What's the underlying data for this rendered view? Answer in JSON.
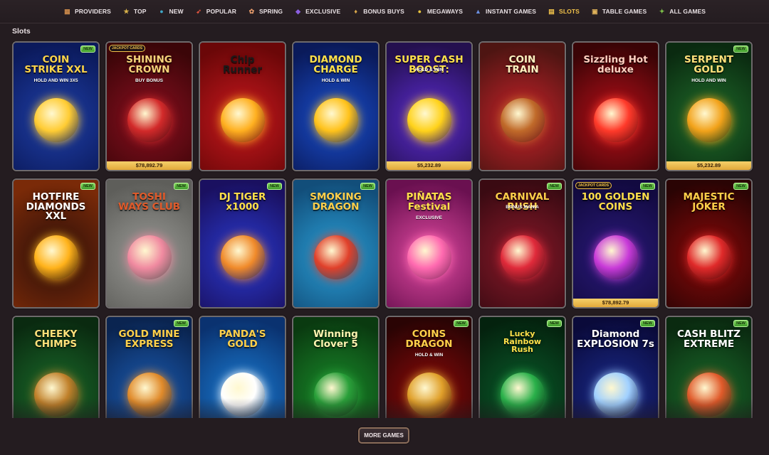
{
  "nav": {
    "items": [
      {
        "label": "PROVIDERS",
        "icon": "providers-icon",
        "glyph": "▦",
        "color": "#c9884a"
      },
      {
        "label": "TOP",
        "icon": "star-icon",
        "glyph": "★",
        "color": "#d8b24a"
      },
      {
        "label": "NEW",
        "icon": "globe-icon",
        "glyph": "●",
        "color": "#3fa7c7"
      },
      {
        "label": "POPULAR",
        "icon": "rocket-icon",
        "glyph": "➶",
        "color": "#e0553f"
      },
      {
        "label": "SPRING",
        "icon": "flower-icon",
        "glyph": "✿",
        "color": "#e59a6a"
      },
      {
        "label": "EXCLUSIVE",
        "icon": "gem-icon",
        "glyph": "◆",
        "color": "#8b5fe0"
      },
      {
        "label": "BONUS BUYS",
        "icon": "money-bag-icon",
        "glyph": "♦",
        "color": "#d9a84a"
      },
      {
        "label": "MEGAWAYS",
        "icon": "coin-icon",
        "glyph": "●",
        "color": "#e7c43e"
      },
      {
        "label": "INSTANT GAMES",
        "icon": "joystick-icon",
        "glyph": "▲",
        "color": "#6a8fe0"
      },
      {
        "label": "SLOTS",
        "icon": "slot-machine-icon",
        "glyph": "▤",
        "color": "#f1c24a",
        "active": true
      },
      {
        "label": "TABLE GAMES",
        "icon": "cards-table-icon",
        "glyph": "▣",
        "color": "#e0b25a"
      },
      {
        "label": "ALL GAMES",
        "icon": "grid-icon",
        "glyph": "✦",
        "color": "#7ec14a"
      }
    ]
  },
  "section": {
    "title": "Slots"
  },
  "games": [
    {
      "title": "COIN\nSTRIKE XXL",
      "subtitle": "HOLD AND WIN 3X5",
      "badge": "NEW",
      "bg": [
        "#1f3fa8",
        "#0b1a5c"
      ],
      "tc": "#ffd54a",
      "emblem": "#ffcc33"
    },
    {
      "title": "SHINING\nCROWN",
      "subtitle": "BUY BONUS",
      "jackpot": "$78,892.79",
      "jackpot_label": "JACKPOT CARDS",
      "bg": [
        "#8a1020",
        "#3b0508"
      ],
      "tc": "#f6d37a",
      "emblem": "#d22a2a"
    },
    {
      "title": "Chip\nRunner",
      "subtitle": "",
      "bg": [
        "#c8181e",
        "#6b0708"
      ],
      "tc": "#1a1a1a",
      "emblem": "#ffb020"
    },
    {
      "title": "DIAMOND\nCHARGE",
      "subtitle": "HOLD & WIN",
      "bg": [
        "#1a4fd0",
        "#0a1a5a"
      ],
      "tc": "#ffe14a",
      "emblem": "#ffc21a"
    },
    {
      "title": "SUPER CASH BOOST:",
      "subtitle": "HOLD & WIN",
      "jackpot": "$5,232.89",
      "bg": [
        "#5b2bd0",
        "#24104f"
      ],
      "tc": "#ffe14a",
      "emblem": "#ffd21a"
    },
    {
      "title": "COIN\nTRAIN",
      "subtitle": "",
      "bg": [
        "#c7222a",
        "#4e1512"
      ],
      "tc": "#fff2c0",
      "emblem": "#c06a2a"
    },
    {
      "title": "Sizzling Hot\ndeluxe",
      "subtitle": "",
      "bg": [
        "#b8101a",
        "#3a0406"
      ],
      "tc": "#ffd0c0",
      "emblem": "#ff3a2a"
    },
    {
      "title": "SERPENT\nGOLD",
      "subtitle": "HOLD AND WIN",
      "badge": "NEW",
      "jackpot": "$5,232.89",
      "bg": [
        "#1f6a2a",
        "#0a2a10"
      ],
      "tc": "#ffe07a",
      "emblem": "#f2a21a"
    },
    {
      "title": "HOTFIRE\nDIAMONDS XXL",
      "subtitle": "",
      "badge": "NEW",
      "bg": [
        "#2a0e0a",
        "#7a2a08"
      ],
      "tc": "#ffffff",
      "emblem": "#ffb21a"
    },
    {
      "title": "TOSHI\nWAYS CLUB",
      "subtitle": "",
      "badge": "NEW",
      "bg": [
        "#9a9a96",
        "#5e5e5a"
      ],
      "tc": "#e05a2a",
      "emblem": "#f08aa0"
    },
    {
      "title": "DJ TIGER\nx1000",
      "subtitle": "",
      "badge": "NEW",
      "bg": [
        "#2a3ad0",
        "#1a1060"
      ],
      "tc": "#ffe04a",
      "emblem": "#f08a2a"
    },
    {
      "title": "SMOKING\nDRAGON",
      "subtitle": "",
      "badge": "NEW",
      "bg": [
        "#2aa0d8",
        "#124e7a"
      ],
      "tc": "#ffcf4a",
      "emblem": "#e0402a"
    },
    {
      "title": "PIÑATAS\nFestival",
      "subtitle": "EXCLUSIVE",
      "bg": [
        "#e04aa0",
        "#6a1050"
      ],
      "tc": "#ffe04a",
      "emblem": "#ff6ab0"
    },
    {
      "title": "CARNIVAL RUSH",
      "subtitle": "BONUS MANIA",
      "badge": "NEW",
      "bg": [
        "#8a1a2a",
        "#3a0a12"
      ],
      "tc": "#ffd04a",
      "emblem": "#e02a3a"
    },
    {
      "title": "100 GOLDEN COINS",
      "subtitle": "",
      "badge": "NEW",
      "jackpot": "$78,892.79",
      "jackpot_label": "JACKPOT CARDS",
      "bg": [
        "#2a1a7a",
        "#120a40"
      ],
      "tc": "#ffe04a",
      "emblem": "#c83ad8"
    },
    {
      "title": "MAJESTIC\nJOKER",
      "subtitle": "",
      "badge": "NEW",
      "bg": [
        "#8a0a0a",
        "#2a0404"
      ],
      "tc": "#ffd04a",
      "emblem": "#e02a2a"
    },
    {
      "title": "CHEEKY\nCHIMPS",
      "subtitle": "",
      "bg": [
        "#1a6a2a",
        "#0a2a10"
      ],
      "tc": "#ffe07a",
      "emblem": "#c0802a"
    },
    {
      "title": "GOLD MINE\nEXPRESS",
      "subtitle": "",
      "badge": "NEW",
      "bg": [
        "#1a5ab0",
        "#0a2450"
      ],
      "tc": "#ffd04a",
      "emblem": "#e08a2a"
    },
    {
      "title": "PANDA'S\nGOLD",
      "subtitle": "",
      "bg": [
        "#1a7ad0",
        "#0a3270"
      ],
      "tc": "#ffd04a",
      "emblem": "#ffffff"
    },
    {
      "title": "Winning\nClover 5",
      "subtitle": "",
      "bg": [
        "#1a8a2a",
        "#0a3a10"
      ],
      "tc": "#fff4b0",
      "emblem": "#2aa03a"
    },
    {
      "title": "COINS\nDRAGON",
      "subtitle": "HOLD & WIN",
      "badge": "NEW",
      "bg": [
        "#8a0a0a",
        "#2a0404"
      ],
      "tc": "#ffd04a",
      "emblem": "#e0a02a"
    },
    {
      "title": "Lucky\nRainbow\nRush",
      "subtitle": "",
      "badge": "NEW",
      "bg": [
        "#0a5a2a",
        "#04220e"
      ],
      "tc": "#ffe04a",
      "emblem": "#2ab04a"
    },
    {
      "title": "Diamond\nEXPLOSION 7s",
      "subtitle": "",
      "badge": "NEW",
      "bg": [
        "#1a2a8a",
        "#0a0a3a"
      ],
      "tc": "#ffffff",
      "emblem": "#a0d0ff"
    },
    {
      "title": "CASH BLITZ\nEXTREME",
      "subtitle": "",
      "badge": "NEW",
      "bg": [
        "#1a6a2a",
        "#0a2a10"
      ],
      "tc": "#ffffff",
      "emblem": "#e05a2a"
    }
  ],
  "more_button": {
    "label": "MORE GAMES"
  }
}
